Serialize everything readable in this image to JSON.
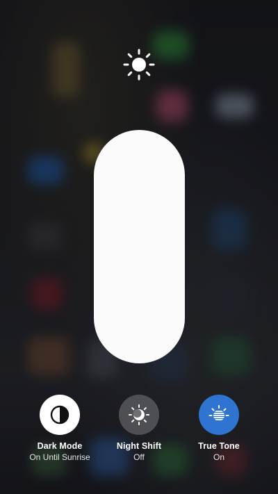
{
  "brightness": {
    "level": 1.0,
    "icon": "sun-icon"
  },
  "controls": [
    {
      "id": "dark-mode",
      "label": "Dark Mode",
      "status": "On Until Sunrise",
      "icon": "dark-mode-icon",
      "color": "#ffffff"
    },
    {
      "id": "night-shift",
      "label": "Night Shift",
      "status": "Off",
      "icon": "night-shift-icon",
      "color": "#7a7a7f"
    },
    {
      "id": "true-tone",
      "label": "True Tone",
      "status": "On",
      "icon": "true-tone-icon",
      "color": "#2f74d0"
    }
  ]
}
